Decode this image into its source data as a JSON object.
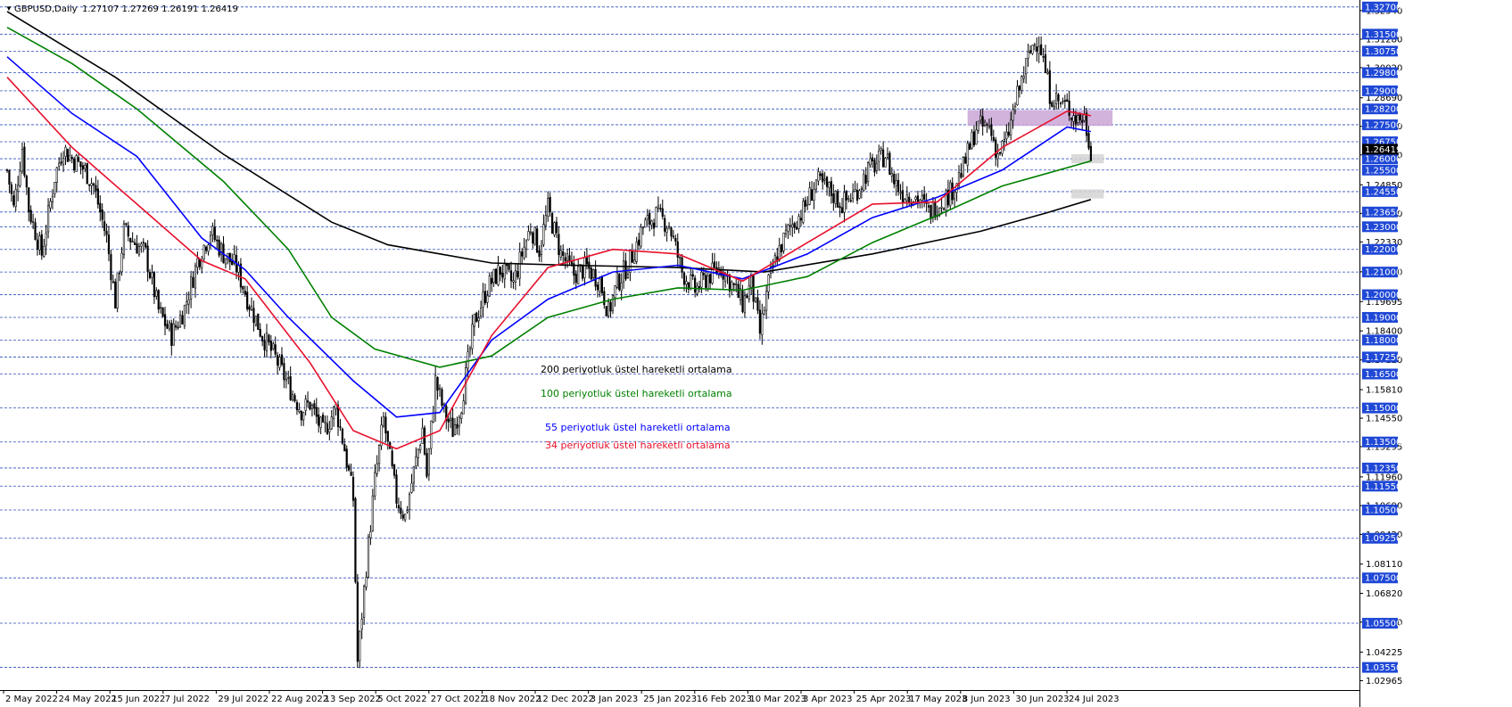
{
  "header": {
    "symbol": "GBPUSD,Daily",
    "ohlc": "1.27107 1.27269 1.26191 1.26419"
  },
  "colors": {
    "background": "#ffffff",
    "grid": "#2f4fbf",
    "candle": "#000000",
    "ema200": "#000000",
    "ema100": "#008000",
    "ema55": "#0000ff",
    "ema34": "#e8102c",
    "resistance_zone": "#c9a6d6",
    "support_zone": "#d4d4d4",
    "level_label_bg": "#1f48d6",
    "current_label_bg": "#000000"
  },
  "annotations": [
    {
      "text": "200 periyotluk üstel hareketli ortalama",
      "color": "#000000"
    },
    {
      "text": "100 periyotluk üstel hareketli ortalama",
      "color": "#008000"
    },
    {
      "text": "55 periyotluk üstel hareketli ortalama",
      "color": "#0000ff"
    },
    {
      "text": "34 periyotluk üstel hareketli ortalama",
      "color": "#e8102c"
    }
  ],
  "chart_data": {
    "type": "candlestick",
    "symbol": "GBPUSD",
    "timeframe": "Daily",
    "last_price": "1.26419",
    "ylim": [
      1.0255,
      1.3285
    ],
    "x_labels": [
      "2 May 2022",
      "24 May 2022",
      "15 Jun 2022",
      "7 Jul 2022",
      "29 Jul 2022",
      "22 Aug 2022",
      "13 Sep 2022",
      "5 Oct 2022",
      "27 Oct 2022",
      "18 Nov 2022",
      "12 Dec 2022",
      "3 Jan 2023",
      "25 Jan 2023",
      "16 Feb 2023",
      "10 Mar 2023",
      "3 Apr 2023",
      "25 Apr 2023",
      "17 May 2023",
      "8 Jun 2023",
      "30 Jun 2023",
      "24 Jul 2023"
    ],
    "level_lines": [
      "1.32700",
      "1.31500",
      "1.30750",
      "1.29800",
      "1.29000",
      "1.28200",
      "1.27500",
      "1.26750",
      "1.26000",
      "1.25500",
      "1.24550",
      "1.23650",
      "1.23000",
      "1.22000",
      "1.21000",
      "1.20000",
      "1.19000",
      "1.18000",
      "1.17250",
      "1.16500",
      "1.15000",
      "1.13500",
      "1.12350",
      "1.11550",
      "1.10500",
      "1.09250",
      "1.07500",
      "1.05500",
      "1.03550"
    ],
    "scale_ticks": [
      "1.32540",
      "1.31280",
      "1.30020",
      "1.28690",
      "1.27430",
      "1.26170",
      "1.24850",
      "1.23590",
      "1.22330",
      "1.21010",
      "1.19695",
      "1.18400",
      "1.17120",
      "1.15810",
      "1.14550",
      "1.13295",
      "1.11960",
      "1.10690",
      "1.09420",
      "1.08110",
      "1.06820",
      "1.05550",
      "1.04225",
      "1.02965"
    ],
    "zones": [
      {
        "type": "resistance",
        "from": 1.2745,
        "to": 1.2815
      },
      {
        "type": "support",
        "from": 1.258,
        "to": 1.262
      },
      {
        "type": "support",
        "from": 1.2425,
        "to": 1.2465
      }
    ],
    "anchors": [
      [
        0,
        1.255
      ],
      [
        3,
        1.238
      ],
      [
        7,
        1.265
      ],
      [
        10,
        1.238
      ],
      [
        16,
        1.218
      ],
      [
        22,
        1.252
      ],
      [
        26,
        1.265
      ],
      [
        28,
        1.262
      ],
      [
        36,
        1.255
      ],
      [
        40,
        1.248
      ],
      [
        46,
        1.225
      ],
      [
        50,
        1.197
      ],
      [
        54,
        1.228
      ],
      [
        58,
        1.224
      ],
      [
        64,
        1.218
      ],
      [
        70,
        1.193
      ],
      [
        76,
        1.182
      ],
      [
        82,
        1.194
      ],
      [
        88,
        1.215
      ],
      [
        94,
        1.228
      ],
      [
        100,
        1.218
      ],
      [
        106,
        1.212
      ],
      [
        112,
        1.196
      ],
      [
        118,
        1.182
      ],
      [
        124,
        1.172
      ],
      [
        130,
        1.16
      ],
      [
        136,
        1.149
      ],
      [
        140,
        1.152
      ],
      [
        146,
        1.139
      ],
      [
        152,
        1.15
      ],
      [
        156,
        1.132
      ],
      [
        160,
        1.11
      ],
      [
        162,
        1.038
      ],
      [
        166,
        1.08
      ],
      [
        170,
        1.118
      ],
      [
        174,
        1.145
      ],
      [
        176,
        1.133
      ],
      [
        180,
        1.11
      ],
      [
        184,
        1.102
      ],
      [
        188,
        1.122
      ],
      [
        192,
        1.141
      ],
      [
        194,
        1.12
      ],
      [
        198,
        1.162
      ],
      [
        202,
        1.148
      ],
      [
        206,
        1.14
      ],
      [
        210,
        1.152
      ],
      [
        216,
        1.188
      ],
      [
        222,
        1.203
      ],
      [
        228,
        1.211
      ],
      [
        234,
        1.205
      ],
      [
        238,
        1.218
      ],
      [
        242,
        1.23
      ],
      [
        246,
        1.22
      ],
      [
        250,
        1.238
      ],
      [
        256,
        1.218
      ],
      [
        262,
        1.209
      ],
      [
        268,
        1.212
      ],
      [
        274,
        1.206
      ],
      [
        278,
        1.192
      ],
      [
        282,
        1.205
      ],
      [
        288,
        1.215
      ],
      [
        294,
        1.23
      ],
      [
        300,
        1.235
      ],
      [
        306,
        1.231
      ],
      [
        312,
        1.21
      ],
      [
        318,
        1.202
      ],
      [
        324,
        1.208
      ],
      [
        330,
        1.212
      ],
      [
        336,
        1.203
      ],
      [
        340,
        1.196
      ],
      [
        344,
        1.205
      ],
      [
        348,
        1.183
      ],
      [
        352,
        1.205
      ],
      [
        356,
        1.218
      ],
      [
        362,
        1.23
      ],
      [
        368,
        1.237
      ],
      [
        374,
        1.25
      ],
      [
        380,
        1.246
      ],
      [
        386,
        1.24
      ],
      [
        392,
        1.245
      ],
      [
        398,
        1.255
      ],
      [
        402,
        1.258
      ],
      [
        406,
        1.262
      ],
      [
        410,
        1.25
      ],
      [
        414,
        1.245
      ],
      [
        418,
        1.244
      ],
      [
        422,
        1.242
      ],
      [
        426,
        1.236
      ],
      [
        430,
        1.24
      ],
      [
        436,
        1.245
      ],
      [
        442,
        1.256
      ],
      [
        448,
        1.274
      ],
      [
        454,
        1.274
      ],
      [
        458,
        1.262
      ],
      [
        462,
        1.268
      ],
      [
        466,
        1.284
      ],
      [
        470,
        1.298
      ],
      [
        474,
        1.31
      ],
      [
        477,
        1.313
      ],
      [
        482,
        1.289
      ],
      [
        486,
        1.285
      ],
      [
        490,
        1.283
      ],
      [
        494,
        1.278
      ],
      [
        498,
        1.278
      ],
      [
        501,
        1.264
      ]
    ],
    "ema200_path": [
      [
        0,
        1.325
      ],
      [
        50,
        1.296
      ],
      [
        100,
        1.262
      ],
      [
        150,
        1.232
      ],
      [
        176,
        1.222
      ],
      [
        200,
        1.218
      ],
      [
        224,
        1.214
      ],
      [
        260,
        1.213
      ],
      [
        310,
        1.212
      ],
      [
        350,
        1.21
      ],
      [
        400,
        1.218
      ],
      [
        450,
        1.228
      ],
      [
        480,
        1.236
      ],
      [
        501,
        1.242
      ]
    ],
    "ema100_path": [
      [
        0,
        1.318
      ],
      [
        30,
        1.302
      ],
      [
        60,
        1.282
      ],
      [
        100,
        1.25
      ],
      [
        130,
        1.22
      ],
      [
        150,
        1.19
      ],
      [
        170,
        1.176
      ],
      [
        200,
        1.168
      ],
      [
        224,
        1.173
      ],
      [
        250,
        1.19
      ],
      [
        280,
        1.198
      ],
      [
        310,
        1.203
      ],
      [
        340,
        1.202
      ],
      [
        370,
        1.208
      ],
      [
        400,
        1.223
      ],
      [
        430,
        1.235
      ],
      [
        460,
        1.248
      ],
      [
        501,
        1.259
      ]
    ],
    "ema55_path": [
      [
        0,
        1.305
      ],
      [
        30,
        1.28
      ],
      [
        60,
        1.261
      ],
      [
        90,
        1.225
      ],
      [
        110,
        1.211
      ],
      [
        130,
        1.19
      ],
      [
        160,
        1.162
      ],
      [
        180,
        1.146
      ],
      [
        200,
        1.148
      ],
      [
        224,
        1.18
      ],
      [
        250,
        1.198
      ],
      [
        280,
        1.21
      ],
      [
        310,
        1.213
      ],
      [
        340,
        1.207
      ],
      [
        370,
        1.218
      ],
      [
        400,
        1.234
      ],
      [
        430,
        1.243
      ],
      [
        460,
        1.255
      ],
      [
        490,
        1.274
      ],
      [
        501,
        1.272
      ]
    ],
    "ema34_path": [
      [
        0,
        1.296
      ],
      [
        30,
        1.265
      ],
      [
        60,
        1.24
      ],
      [
        90,
        1.215
      ],
      [
        110,
        1.207
      ],
      [
        140,
        1.17
      ],
      [
        160,
        1.14
      ],
      [
        180,
        1.132
      ],
      [
        200,
        1.14
      ],
      [
        224,
        1.182
      ],
      [
        250,
        1.212
      ],
      [
        280,
        1.22
      ],
      [
        310,
        1.218
      ],
      [
        340,
        1.206
      ],
      [
        370,
        1.223
      ],
      [
        400,
        1.24
      ],
      [
        430,
        1.241
      ],
      [
        460,
        1.265
      ],
      [
        490,
        1.281
      ],
      [
        501,
        1.279
      ]
    ]
  }
}
